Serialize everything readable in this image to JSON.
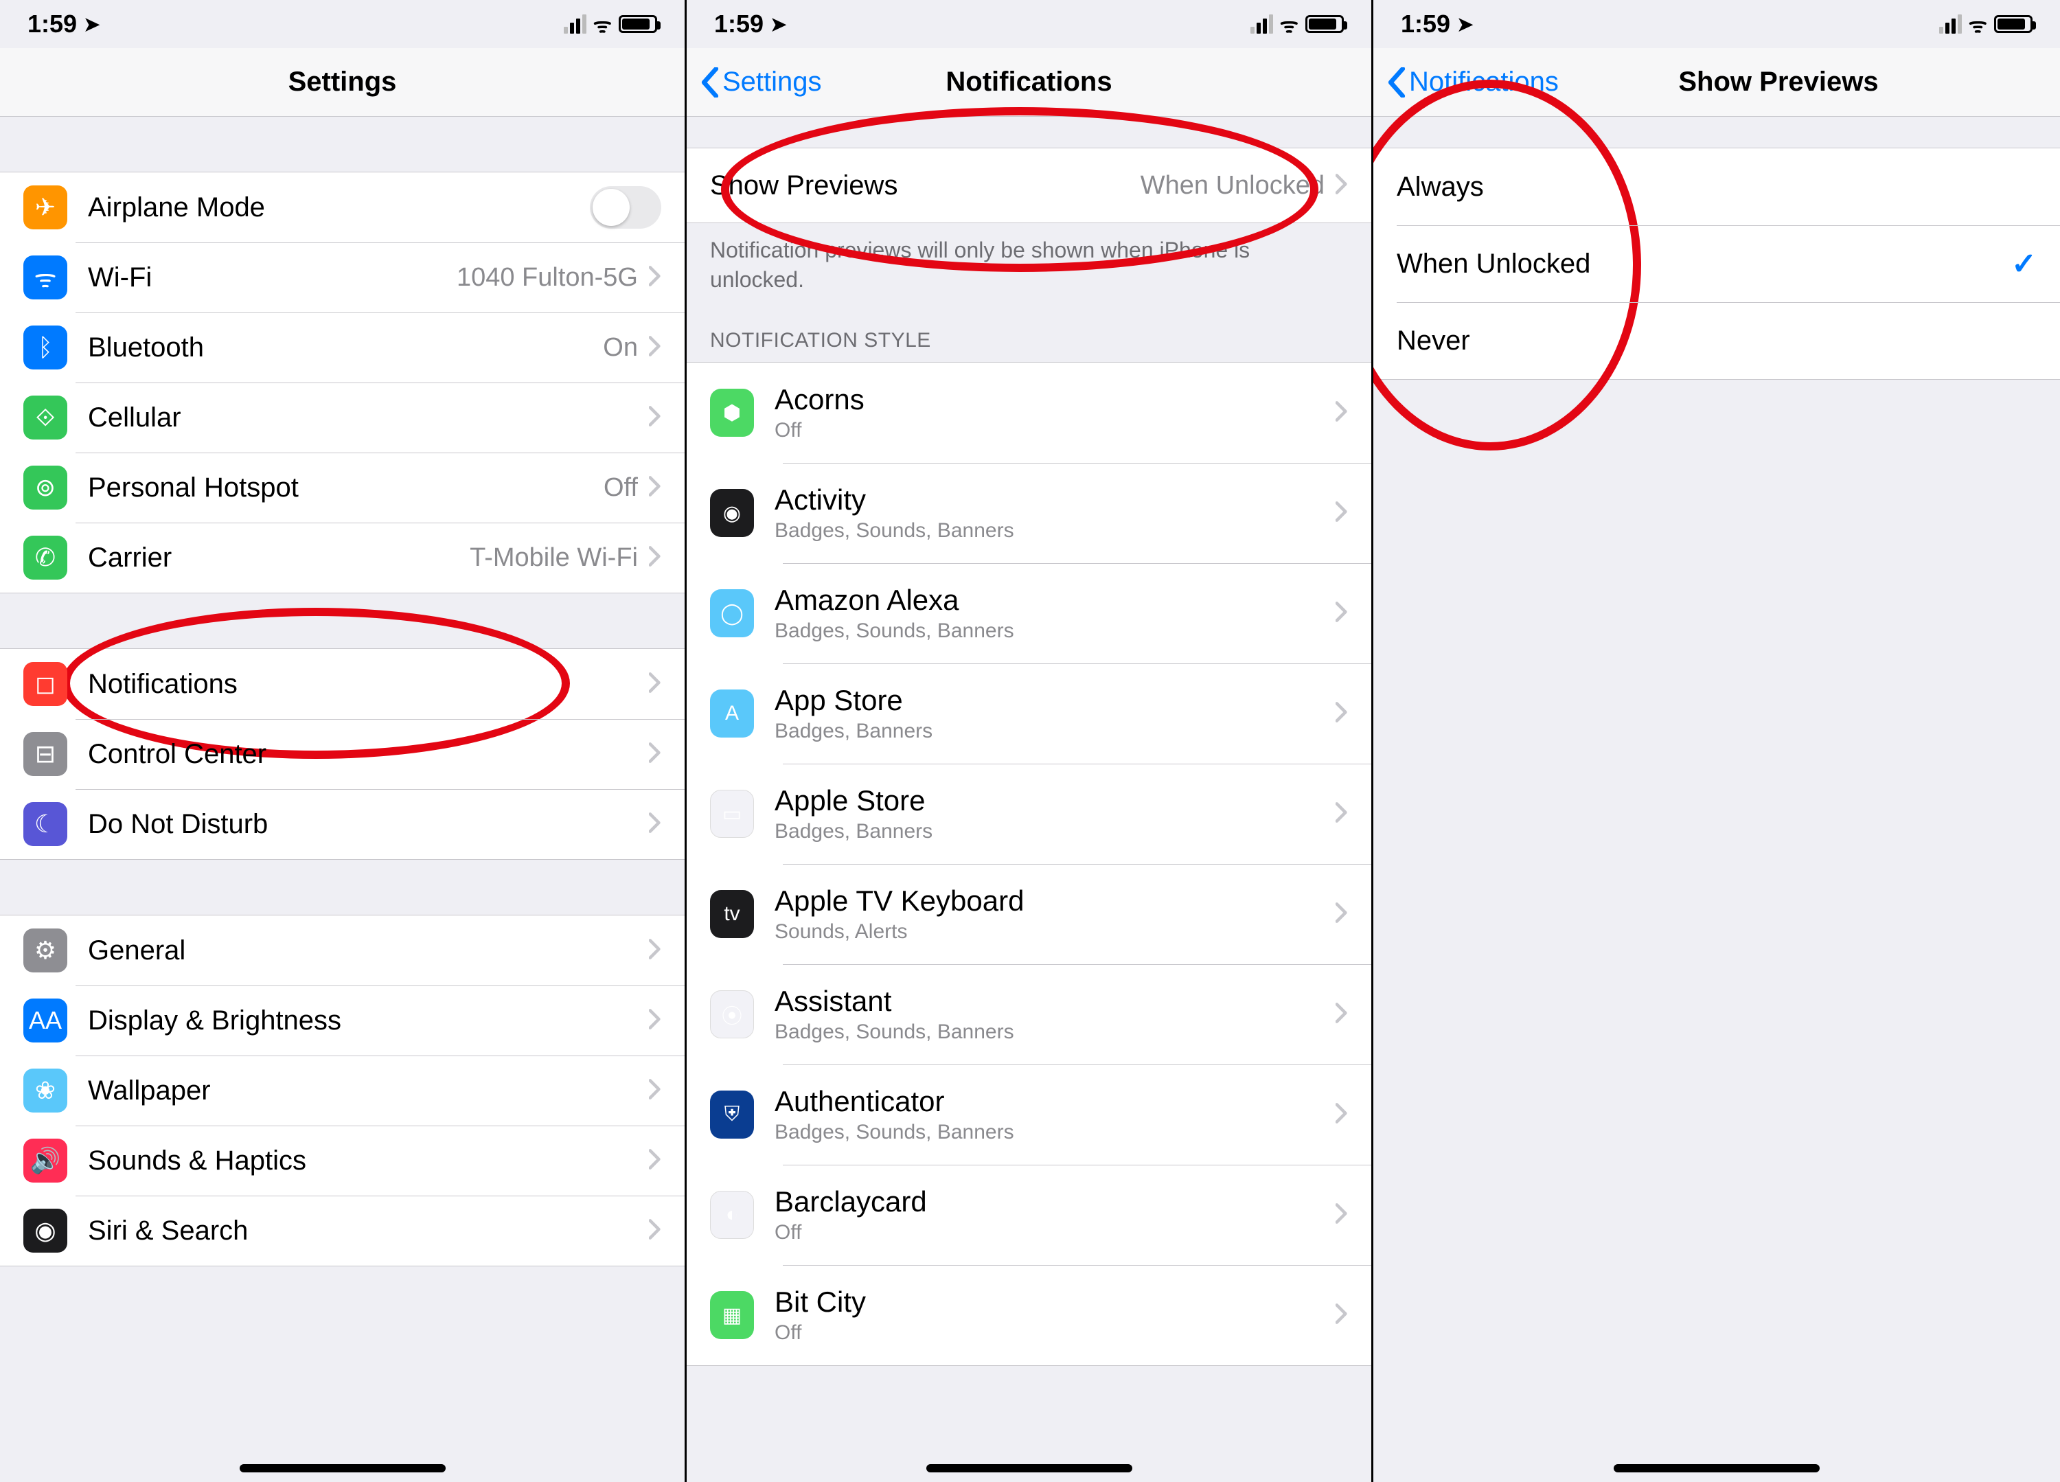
{
  "status": {
    "time": "1:59",
    "location_icon": "location-arrow"
  },
  "screen1": {
    "title": "Settings",
    "group1": [
      {
        "icon": "airplane-icon",
        "color": "ic-orange",
        "glyph": "✈",
        "label": "Airplane Mode",
        "toggle": true
      },
      {
        "icon": "wifi-icon",
        "color": "ic-blue",
        "glyph": "ᯤ",
        "label": "Wi-Fi",
        "value": "1040 Fulton-5G"
      },
      {
        "icon": "bluetooth-icon",
        "color": "ic-blue",
        "glyph": "ᛒ",
        "label": "Bluetooth",
        "value": "On"
      },
      {
        "icon": "cellular-icon",
        "color": "ic-green",
        "glyph": "⟐",
        "label": "Cellular"
      },
      {
        "icon": "hotspot-icon",
        "color": "ic-green",
        "glyph": "⊚",
        "label": "Personal Hotspot",
        "value": "Off"
      },
      {
        "icon": "carrier-icon",
        "color": "ic-phone",
        "glyph": "✆",
        "label": "Carrier",
        "value": "T-Mobile Wi-Fi"
      }
    ],
    "group2": [
      {
        "icon": "notifications-icon",
        "color": "ic-red",
        "glyph": "◻",
        "label": "Notifications"
      },
      {
        "icon": "control-center-icon",
        "color": "ic-grey",
        "glyph": "⊟",
        "label": "Control Center"
      },
      {
        "icon": "dnd-icon",
        "color": "ic-purple",
        "glyph": "☾",
        "label": "Do Not Disturb"
      }
    ],
    "group3": [
      {
        "icon": "general-icon",
        "color": "ic-grey",
        "glyph": "⚙",
        "label": "General"
      },
      {
        "icon": "display-icon",
        "color": "ic-blue",
        "glyph": "AA",
        "label": "Display & Brightness"
      },
      {
        "icon": "wallpaper-icon",
        "color": "ic-teal",
        "glyph": "❀",
        "label": "Wallpaper"
      },
      {
        "icon": "sounds-icon",
        "color": "ic-pink",
        "glyph": "🔊",
        "label": "Sounds & Haptics"
      },
      {
        "icon": "siri-icon",
        "color": "ic-dark",
        "glyph": "◉",
        "label": "Siri & Search"
      }
    ]
  },
  "screen2": {
    "back": "Settings",
    "title": "Notifications",
    "show_previews_label": "Show Previews",
    "show_previews_value": "When Unlocked",
    "footer": "Notification previews will only be shown when iPhone is unlocked.",
    "style_header": "NOTIFICATION STYLE",
    "apps": [
      {
        "name": "Acorns",
        "sub": "Off",
        "color": "ic-lgreen",
        "glyph": "⬢"
      },
      {
        "name": "Activity",
        "sub": "Badges, Sounds, Banners",
        "color": "ic-dark",
        "glyph": "◉"
      },
      {
        "name": "Amazon Alexa",
        "sub": "Badges, Sounds, Banners",
        "color": "ic-sky",
        "glyph": "◯"
      },
      {
        "name": "App Store",
        "sub": "Badges, Banners",
        "color": "ic-sky",
        "glyph": "A"
      },
      {
        "name": "Apple Store",
        "sub": "Badges, Banners",
        "color": "ic-white",
        "glyph": "▭"
      },
      {
        "name": "Apple TV Keyboard",
        "sub": "Sounds, Alerts",
        "color": "ic-dark",
        "glyph": "tv"
      },
      {
        "name": "Assistant",
        "sub": "Badges, Sounds, Banners",
        "color": "ic-white",
        "glyph": "⦿"
      },
      {
        "name": "Authenticator",
        "sub": "Badges, Sounds, Banners",
        "color": "ic-navy",
        "glyph": "⛨"
      },
      {
        "name": "Barclaycard",
        "sub": "Off",
        "color": "ic-white",
        "glyph": "◐"
      },
      {
        "name": "Bit City",
        "sub": "Off",
        "color": "ic-lgreen",
        "glyph": "▦"
      }
    ]
  },
  "screen3": {
    "back": "Notifications",
    "title": "Show Previews",
    "options": [
      {
        "label": "Always",
        "checked": false
      },
      {
        "label": "When Unlocked",
        "checked": true
      },
      {
        "label": "Never",
        "checked": false
      }
    ]
  }
}
